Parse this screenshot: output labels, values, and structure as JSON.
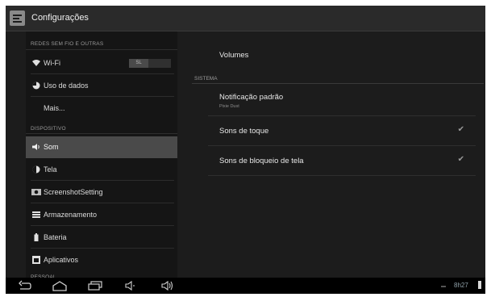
{
  "actionbar": {
    "title": "Configurações"
  },
  "sidebar": {
    "section_wireless": "REDES SEM FIO E OUTRAS",
    "wifi": {
      "label": "Wi-Fi",
      "toggle": "SL"
    },
    "data_usage": "Uso de dados",
    "more": "Mais...",
    "section_device": "DISPOSITIVO",
    "sound": "Som",
    "display": "Tela",
    "screenshot": "ScreenshotSetting",
    "storage": "Armazenamento",
    "battery": "Bateria",
    "apps": "Aplicativos",
    "section_personal": "PESSOAL"
  },
  "content": {
    "volumes": "Volumes",
    "section_system": "SISTEMA",
    "notification": {
      "title": "Notificação padrão",
      "value": "Pixie Dust"
    },
    "touch_sounds": {
      "label": "Sons de toque",
      "checked": true
    },
    "lock_sounds": {
      "label": "Sons de bloqueio de tela",
      "checked": true
    },
    "check_glyph": "✔"
  },
  "statusbar": {
    "time": "8h27"
  },
  "icons": {
    "wifi": "wifi-icon",
    "data": "data-usage-icon",
    "sound": "speaker-icon",
    "display": "brightness-icon",
    "screenshot": "camera-icon",
    "storage": "storage-icon",
    "battery": "battery-icon",
    "apps": "apps-icon"
  }
}
